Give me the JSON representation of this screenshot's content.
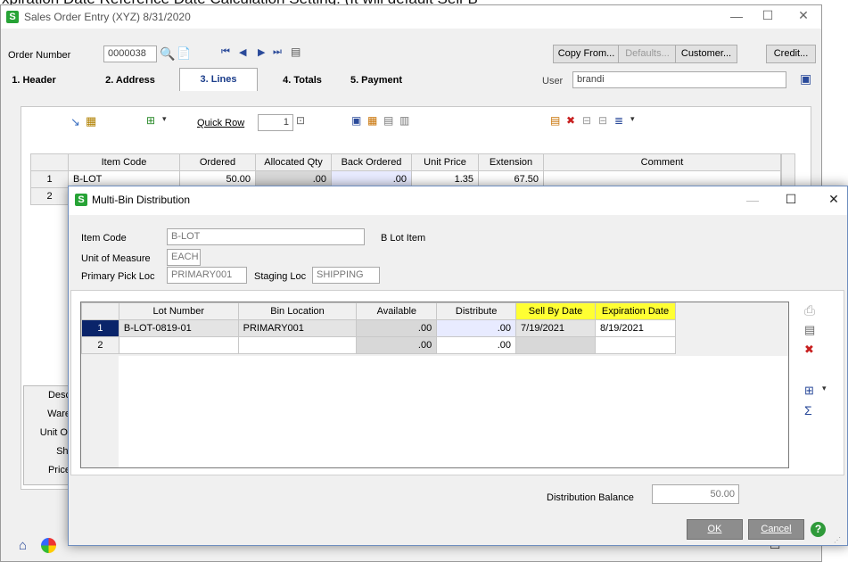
{
  "background_text": "xpiration Date Reference Date Calculation Setting. (It will default Sell-B",
  "main": {
    "title": "Sales Order Entry (XYZ) 8/31/2020",
    "order_label": "Order Number",
    "order_value": "0000038",
    "copy_from": "Copy From...",
    "defaults": "Defaults...",
    "customer": "Customer...",
    "credit": "Credit...",
    "user_label": "User",
    "user_value": "brandi",
    "tabs": [
      "1. Header",
      "2. Address",
      "3. Lines",
      "4. Totals",
      "5. Payment"
    ],
    "quick_row_label": "Quick Row",
    "quick_row_value": "1",
    "grid": {
      "columns": [
        "Item Code",
        "Ordered",
        "Allocated Qty",
        "Back Ordered",
        "Unit Price",
        "Extension",
        "Comment"
      ],
      "rows": [
        {
          "num": "1",
          "item": "B-LOT",
          "ordered": "50.00",
          "allocated": ".00",
          "back": ".00",
          "price": "1.35",
          "ext": "67.50",
          "comment": ""
        },
        {
          "num": "2",
          "item": "",
          "ordered": "",
          "allocated": "",
          "back": "",
          "price": "",
          "ext": "",
          "comment": ""
        }
      ]
    },
    "side_labels": [
      "Desc",
      "Ware",
      "Unit Of",
      "Shi",
      "Price"
    ]
  },
  "dialog": {
    "title": "Multi-Bin Distribution",
    "item_code_label": "Item Code",
    "item_code_value": "B-LOT",
    "item_desc": "B Lot Item",
    "uom_label": "Unit of Measure",
    "uom_value": "EACH",
    "pick_label": "Primary Pick Loc",
    "pick_value": "PRIMARY001",
    "staging_label": "Staging Loc",
    "staging_value": "SHIPPING",
    "grid": {
      "columns": [
        "Lot Number",
        "Bin Location",
        "Available",
        "Distribute",
        "Sell By Date",
        "Expiration Date"
      ],
      "rows": [
        {
          "num": "1",
          "lot": "B-LOT-0819-01",
          "bin": "PRIMARY001",
          "available": ".00",
          "distribute": ".00",
          "sellby": "7/19/2021",
          "exp": "8/19/2021"
        },
        {
          "num": "2",
          "lot": "",
          "bin": "",
          "available": ".00",
          "distribute": ".00",
          "sellby": "",
          "exp": ""
        }
      ]
    },
    "balance_label": "Distribution Balance",
    "balance_value": "50.00",
    "ok": "OK",
    "cancel": "Cancel"
  },
  "colors": {
    "highlight": "#ffff33",
    "row_select": "#0a246a",
    "distribute_cell": "#e8ebff"
  }
}
